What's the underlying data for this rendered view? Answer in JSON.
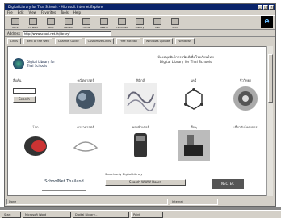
{
  "window": {
    "title": "Digital Library for Thai Schools - Microsoft Internet Explorer",
    "controls": [
      "_",
      "□",
      "×"
    ]
  },
  "menubar": [
    "File",
    "Edit",
    "View",
    "Favorites",
    "Tools",
    "Help"
  ],
  "toolbar": {
    "buttons": [
      {
        "label": "Back",
        "icon": "back-arrow-icon"
      },
      {
        "label": "Forward",
        "icon": "forward-arrow-icon"
      },
      {
        "label": "Stop",
        "icon": "stop-icon"
      },
      {
        "label": "Refresh",
        "icon": "refresh-icon"
      },
      {
        "label": "Home",
        "icon": "home-icon"
      },
      {
        "label": "Search",
        "icon": "search-icon"
      },
      {
        "label": "Favorites",
        "icon": "favorites-icon"
      },
      {
        "label": "History",
        "icon": "history-icon"
      },
      {
        "label": "Mail",
        "icon": "mail-icon"
      },
      {
        "label": "Print",
        "icon": "print-icon"
      }
    ]
  },
  "address": {
    "label": "Address",
    "value": "http://www.school.net.th/library/"
  },
  "links": [
    "Links",
    "Best of the Web",
    "Channel Guide",
    "Customize Links",
    "Free HotMail",
    "Windows Update",
    "Windows"
  ],
  "page": {
    "logo_text_1": "Digital Library for",
    "logo_text_2": "Thai Schools",
    "heading_1": "ห้องสมุดอิเล็กทรอนิกส์เพื่อโรงเรียนไทย",
    "heading_2": "Digital Library for Thai Schools",
    "search": {
      "label": "สืบค้น",
      "button": "Search",
      "value": ""
    },
    "tiles": [
      {
        "label": "คณิตศาสตร์"
      },
      {
        "label": "ฟิสิกส์"
      },
      {
        "label": "เคมี"
      },
      {
        "label": "ชีววิทยา"
      },
      {
        "label": "โลก"
      },
      {
        "label": "ดาราศาสตร์"
      },
      {
        "label": "คอมพิวเตอร์"
      },
      {
        "label": "อื่นๆ"
      },
      {
        "label": "เกี่ยวกับโครงการ"
      }
    ],
    "footer": {
      "left": "SchoolNet Thailand",
      "check": "Search only Digital Library",
      "button": "Search WWW Board",
      "right": "NECTEC"
    }
  },
  "status": {
    "text": "Done",
    "zone": "Internet"
  },
  "taskbar": [
    "Start",
    "Microsoft Word",
    "Digital Library...",
    "Paint"
  ]
}
